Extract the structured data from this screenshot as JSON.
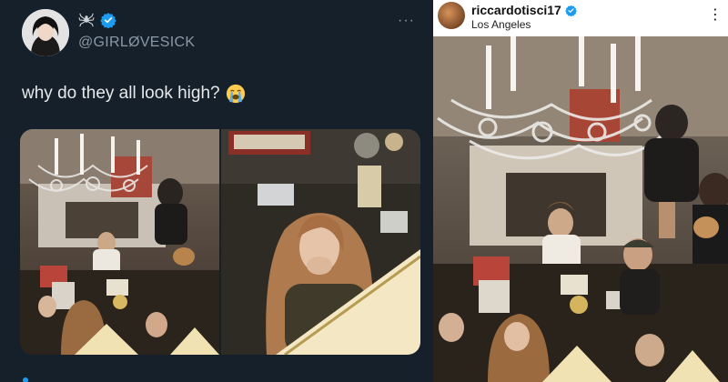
{
  "tweet": {
    "handle": "@GIRLØVESICK",
    "text": "why do they all look high?",
    "more": "···",
    "icons": [
      "avatar",
      "spider-icon",
      "verified-icon",
      "sob-emoji-icon",
      "more-icon"
    ]
  },
  "instagram": {
    "username": "riccardotisci17",
    "location": "Los Angeles",
    "more": "⋮",
    "icons": [
      "avatar",
      "verified-icon",
      "more-icon"
    ]
  },
  "colors": {
    "tweet_bg": "#15202b",
    "tweet_text": "#e7e9ea",
    "tweet_muted": "#8b98a5",
    "verified_blue": "#1d9bf0",
    "insta_bg": "#ffffff"
  }
}
